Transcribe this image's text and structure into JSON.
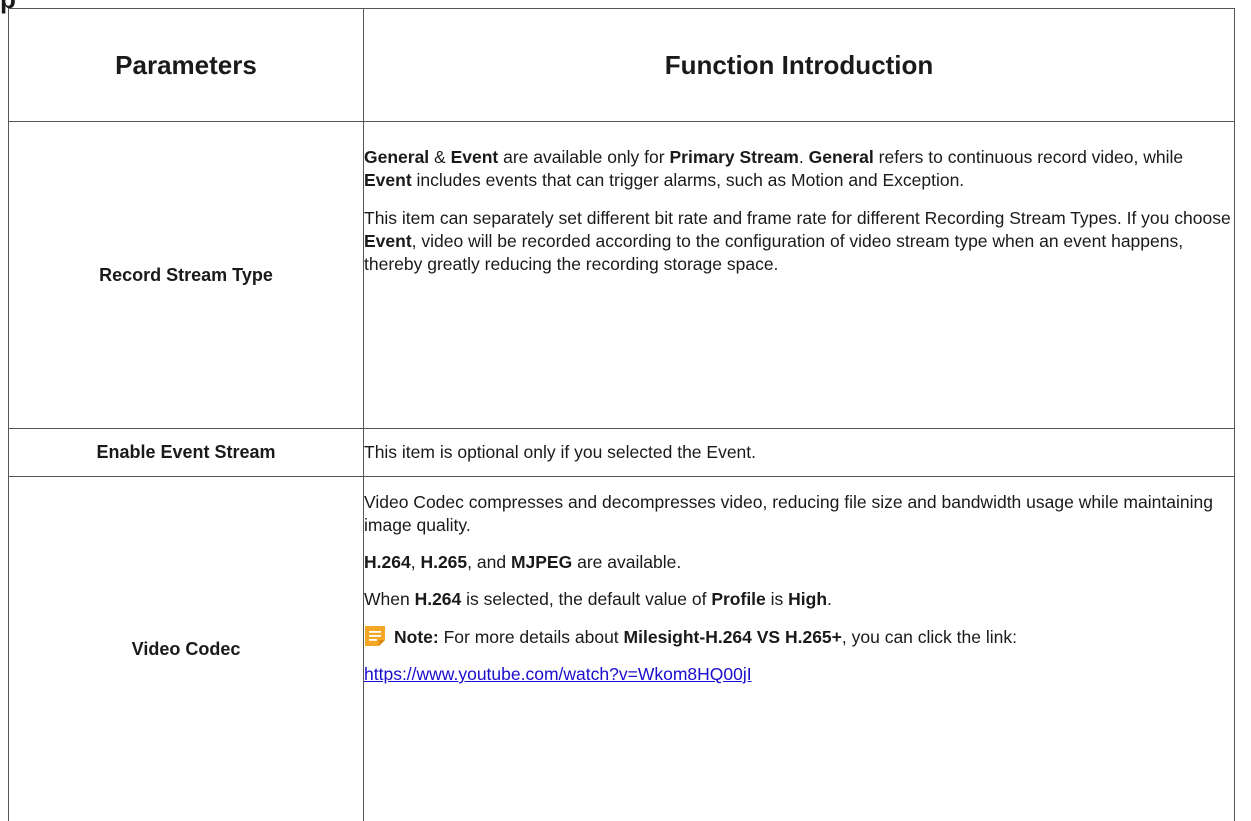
{
  "cut_heading": "p",
  "table": {
    "headers": {
      "parameters": "Parameters",
      "function": "Function Introduction"
    },
    "rows": [
      {
        "param": "Record Stream Type",
        "p1": [
          {
            "t": "General",
            "b": true
          },
          {
            "t": " & ",
            "b": false
          },
          {
            "t": "Event",
            "b": true
          },
          {
            "t": " are available only for ",
            "b": false
          },
          {
            "t": "Primary Stream",
            "b": true
          },
          {
            "t": ". ",
            "b": false
          },
          {
            "t": "General",
            "b": true
          },
          {
            "t": "  refers to continuous record video, while ",
            "b": false
          },
          {
            "t": "Event",
            "b": true
          },
          {
            "t": " includes events that can trigger alarms, such as Motion and Exception.",
            "b": false
          }
        ],
        "p2": [
          {
            "t": "This item can separately set different bit rate and frame rate for different Recording Stream Types. If you choose ",
            "b": false
          },
          {
            "t": "Event",
            "b": true
          },
          {
            "t": ", video will be recorded according to the configuration of video stream type when an event happens, thereby greatly reducing the recording storage space.",
            "b": false
          }
        ]
      },
      {
        "param": "Enable Event Stream",
        "text": "This item is optional only if you selected the Event."
      },
      {
        "param": "Video Codec",
        "p1": "Video Codec compresses and decompresses video, reducing file size and bandwidth usage while maintaining image quality.",
        "p2": {
          "codec1": "H.264",
          "sep1": ", ",
          "codec2": "H.265",
          "sep2": ", and ",
          "codec3": "MJPEG",
          "tail": " are available."
        },
        "p3": {
          "pre": "When ",
          "codec": "H.264",
          "mid": " is selected, the default value of ",
          "profile": "Profile",
          "is": " is ",
          "value": "High",
          "end": "."
        },
        "note": {
          "label": "Note:",
          "pre": "  For more details about ",
          "bold": "Milesight-H.264 VS H.265+",
          "post": ", you can click the link:"
        },
        "link": "https://www.youtube.com/watch?v=Wkom8HQ00jI"
      }
    ]
  },
  "colors": {
    "note_icon": "#f5a623",
    "link": "#1a0dcc",
    "border": "#555555"
  }
}
